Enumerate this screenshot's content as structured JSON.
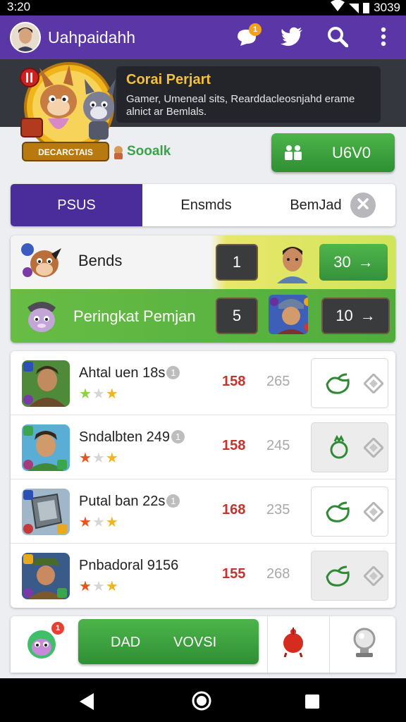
{
  "status_bar": {
    "time": "3:20",
    "battery": "3039"
  },
  "app_bar": {
    "title": "Uahpaidahh",
    "notification_count": "1",
    "colors": {
      "background": "#5a36a6"
    }
  },
  "hero": {
    "title": "Corai Perjart",
    "description": "Gamer, Umeneal sits, Rearddacleosnjahd erame alnict ar Bemlals.",
    "banner_text": "DECARCTAIS"
  },
  "logo_label": "Sooalk",
  "primary_button": {
    "label": "U6V0"
  },
  "tabs": [
    {
      "label": "PSUS",
      "active": true
    },
    {
      "label": "Ensmds",
      "active": false
    },
    {
      "label": "BemJad",
      "active": false
    }
  ],
  "ranking": {
    "rows": [
      {
        "label": "Bends",
        "rank": "1",
        "score": "30",
        "score_arrow": "→"
      },
      {
        "label": "Peringkat Pemjan",
        "rank": "5",
        "score": "10",
        "score_arrow": "→"
      }
    ]
  },
  "list": {
    "items": [
      {
        "name": "Ahtal uen 18s",
        "info": "1",
        "stars": [
          "★",
          "★",
          "★"
        ],
        "rating": 1,
        "value1": "158",
        "value2": "265",
        "icon": "seed-icon"
      },
      {
        "name": "Sndalbten 249",
        "info": "1",
        "stars": [
          "★",
          "★",
          "★"
        ],
        "rating": 1,
        "value1": "158",
        "value2": "245",
        "icon": "pomegranate-icon"
      },
      {
        "name": "Putal ban 22s",
        "info": "1",
        "stars": [
          "★",
          "★",
          "★"
        ],
        "rating": 1,
        "value1": "168",
        "value2": "235",
        "icon": "seed-icon"
      },
      {
        "name": "Pnbadoral 9156",
        "info": "",
        "stars": [
          "★",
          "★",
          "★"
        ],
        "rating": 1,
        "value1": "155",
        "value2": "268",
        "icon": "seed-icon"
      }
    ]
  },
  "bottom_bar": {
    "badge": "1",
    "play_label_left": "DAD",
    "play_label_right": "VOVSI"
  }
}
